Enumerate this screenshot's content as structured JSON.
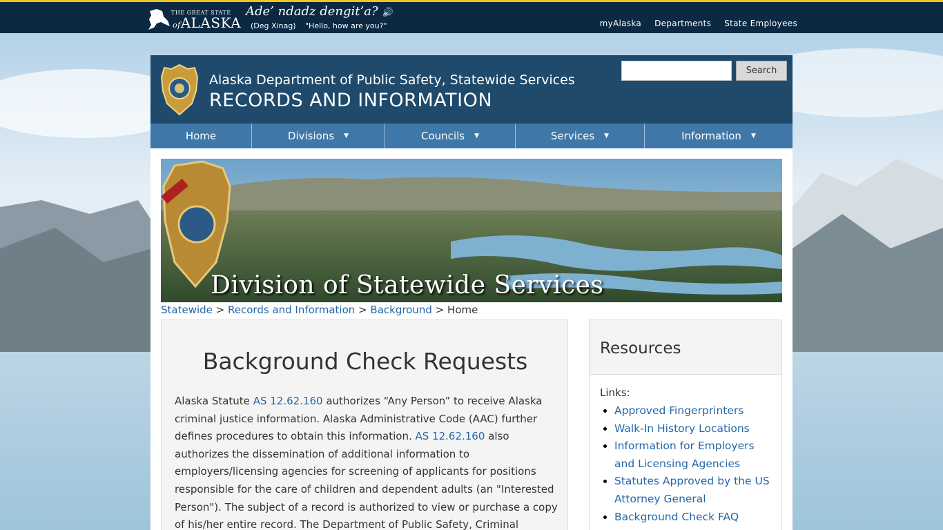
{
  "topbar": {
    "logo_small": "THE GREAT STATE",
    "logo_of": "of",
    "logo_big": "ALASKA",
    "phrase": "Ade’ ndadz dengit’a?",
    "speaker_icon": "speaker-icon",
    "language": "(Deg Xinag)",
    "translation": "\"Hello, how are you?\"",
    "links": [
      "myAlaska",
      "Departments",
      "State Employees"
    ]
  },
  "header": {
    "agency": "Alaska Department of Public Safety, Statewide Services",
    "section": "RECORDS AND INFORMATION",
    "search_placeholder": "",
    "search_button": "Search"
  },
  "nav": {
    "items": [
      {
        "label": "Home",
        "has_dropdown": false
      },
      {
        "label": "Divisions",
        "has_dropdown": true
      },
      {
        "label": "Councils",
        "has_dropdown": true
      },
      {
        "label": "Services",
        "has_dropdown": true
      },
      {
        "label": "Information",
        "has_dropdown": true
      }
    ]
  },
  "banner": {
    "title": "Division of Statewide Services"
  },
  "breadcrumb": {
    "items": [
      "Statewide",
      "Records and Information",
      "Background"
    ],
    "separator": ">",
    "current": "Home"
  },
  "main": {
    "heading": "Background Check Requests",
    "p1_a": "Alaska Statute ",
    "link1": "AS 12.62.160",
    "p1_b": " authorizes “Any Person” to receive Alaska criminal justice information. Alaska Administrative Code (AAC) further defines procedures to obtain this information. ",
    "link2": "AS 12.62.160",
    "p1_c": " also authorizes the dissemination of additional information to employers/licensing agencies for screening of applicants for positions responsible for the care of children and dependent adults (an \"Interested Person\"). The subject of a record is authorized to view or purchase a copy of his/her entire record. The Department of Public Safety, Criminal"
  },
  "sidebar": {
    "title": "Resources",
    "links_label": "Links:",
    "links": [
      "Approved Fingerprinters",
      "Walk-In History Locations",
      "Information for Employers and Licensing Agencies",
      "Statutes Approved by the US Attorney General",
      "Background Check FAQ"
    ]
  },
  "colors": {
    "topbar": "#0b2942",
    "topbar_accent": "#f0c419",
    "header": "#1f4a6b",
    "nav": "#3e77a8",
    "link": "#2366a8"
  }
}
